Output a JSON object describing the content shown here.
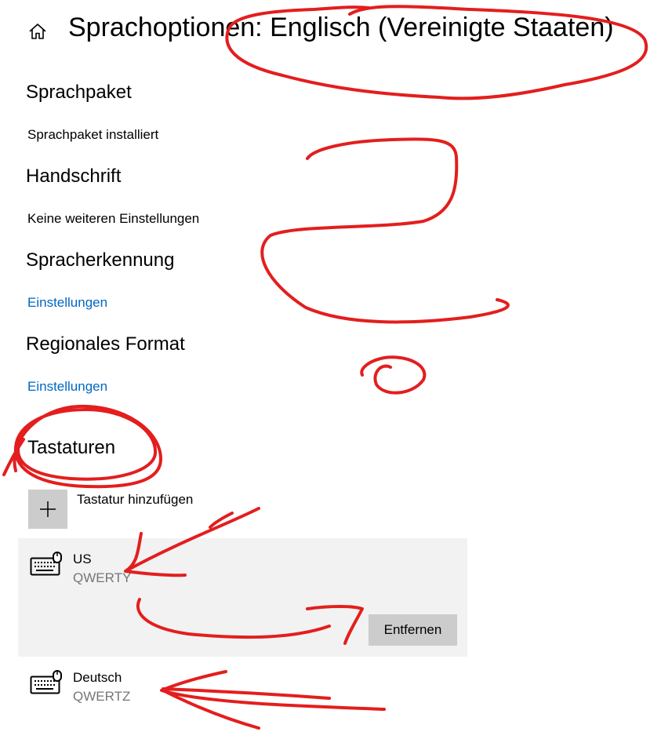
{
  "header": {
    "title": "Sprachoptionen: Englisch (Vereinigte Staaten)",
    "home_icon": "home-icon"
  },
  "sections": {
    "language_pack": {
      "heading": "Sprachpaket",
      "status": "Sprachpaket installiert"
    },
    "handwriting": {
      "heading": "Handschrift",
      "status": "Keine weiteren Einstellungen"
    },
    "speech": {
      "heading": "Spracherkennung",
      "link": "Einstellungen"
    },
    "regional_format": {
      "heading": "Regionales Format",
      "link": "Einstellungen"
    },
    "keyboards": {
      "heading": "Tastaturen",
      "add_label": "Tastatur hinzufügen",
      "add_icon": "plus-icon",
      "items": [
        {
          "name": "US",
          "layout": "QWERTY",
          "icon": "keyboard-icon",
          "selected": true
        },
        {
          "name": "Deutsch",
          "layout": "QWERTZ",
          "icon": "keyboard-icon",
          "selected": false
        }
      ],
      "remove_label": "Entfernen"
    }
  },
  "colors": {
    "link": "#0067c0",
    "secondary_text": "#767676",
    "selected_bg": "#f2f2f2",
    "button_bg": "#cccccc",
    "annotation": "#e31e1e"
  }
}
